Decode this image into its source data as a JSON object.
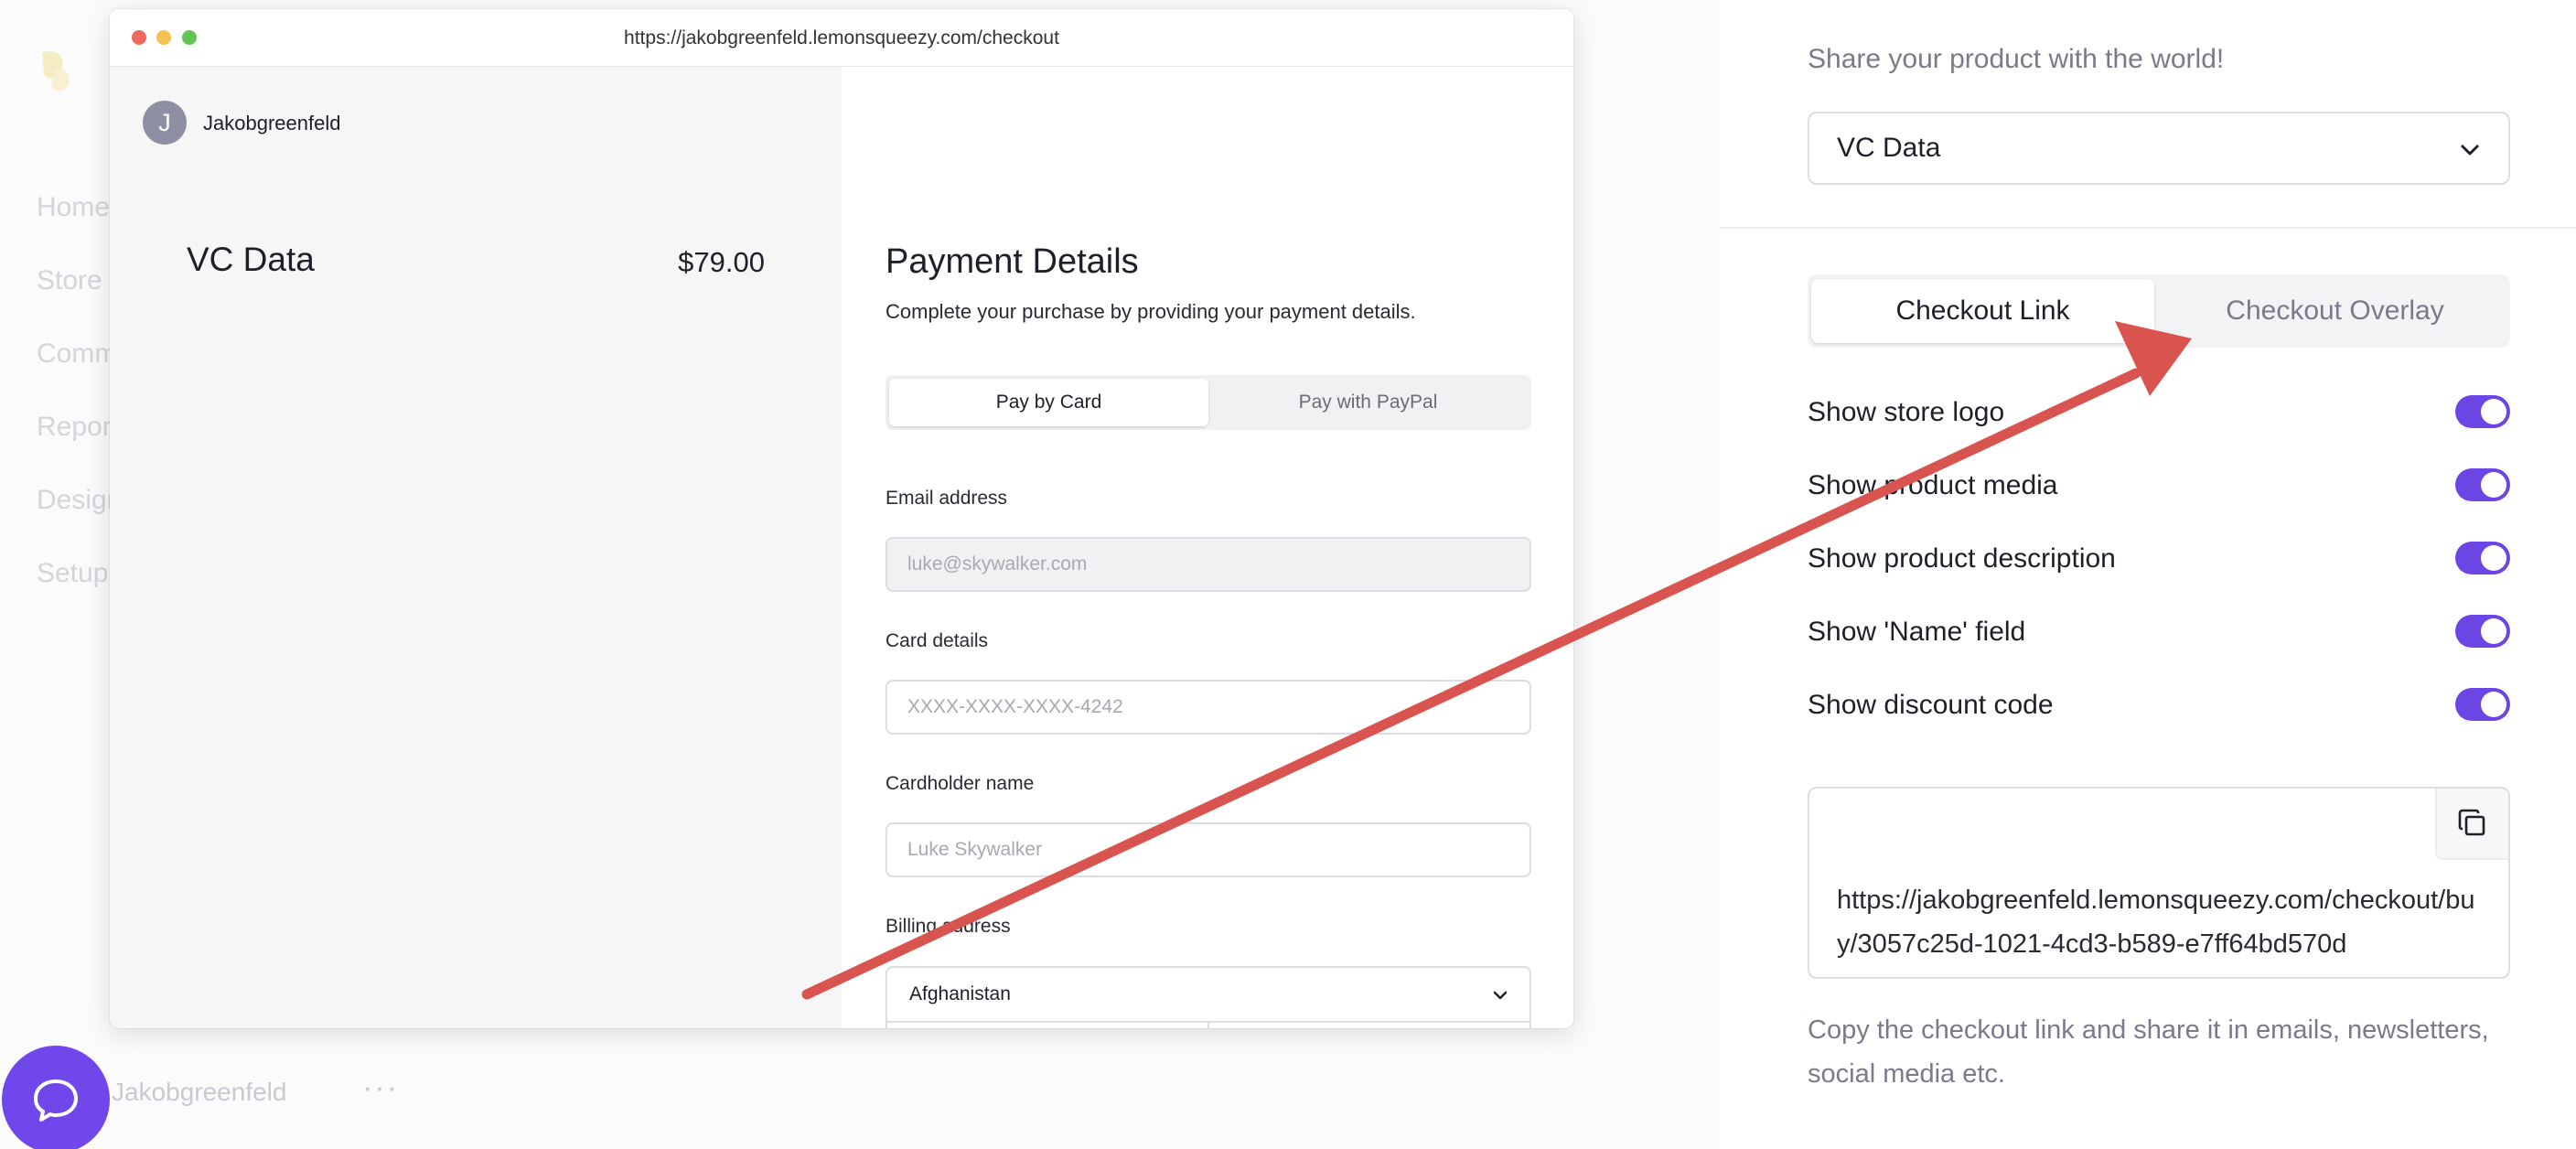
{
  "background_app": {
    "nav_items": [
      "Home",
      "Store",
      "Comm",
      "Repor",
      "Design",
      "Setup"
    ],
    "footer_name": "Jakobgreenfeld",
    "footer_more": "···"
  },
  "browser": {
    "url": "https://jakobgreenfeld.lemonsqueezy.com/checkout",
    "store": {
      "avatar_letter": "J",
      "name": "Jakobgreenfeld"
    },
    "product": {
      "name": "VC Data",
      "price": "$79.00"
    },
    "payment": {
      "title": "Payment Details",
      "subtitle": "Complete your purchase by providing your payment details.",
      "tabs": [
        "Pay by Card",
        "Pay with PayPal"
      ],
      "email_label": "Email address",
      "email_placeholder": "luke@skywalker.com",
      "card_label": "Card details",
      "card_placeholder": "XXXX-XXXX-XXXX-4242",
      "cardholder_label": "Cardholder name",
      "cardholder_placeholder": "Luke Skywalker",
      "billing_label": "Billing address",
      "country": "Afghanistan"
    }
  },
  "settings": {
    "share_text": "Share your product with the world!",
    "product_select": "VC Data",
    "tabs": [
      "Checkout Link",
      "Checkout Overlay"
    ],
    "options": [
      {
        "label": "Show store logo",
        "enabled": true
      },
      {
        "label": "Show product media",
        "enabled": true
      },
      {
        "label": "Show product description",
        "enabled": true
      },
      {
        "label": "Show 'Name' field",
        "enabled": true
      },
      {
        "label": "Show discount code",
        "enabled": true
      }
    ],
    "checkout_link": "https://jakobgreenfeld.lemonsqueezy.com/checkout/buy/3057c25d-1021-4cd3-b589-e7ff64bd570d",
    "helper_text": "Copy the checkout link and share it in emails, newsletters, social media etc."
  },
  "colors": {
    "accent": "#6b46e5",
    "annotation_arrow": "#d9534f",
    "chat_bubble": "#7047eb"
  },
  "icons": [
    "lemon-logo-icon",
    "chevron-down-icon",
    "copy-icon",
    "chat-icon"
  ]
}
